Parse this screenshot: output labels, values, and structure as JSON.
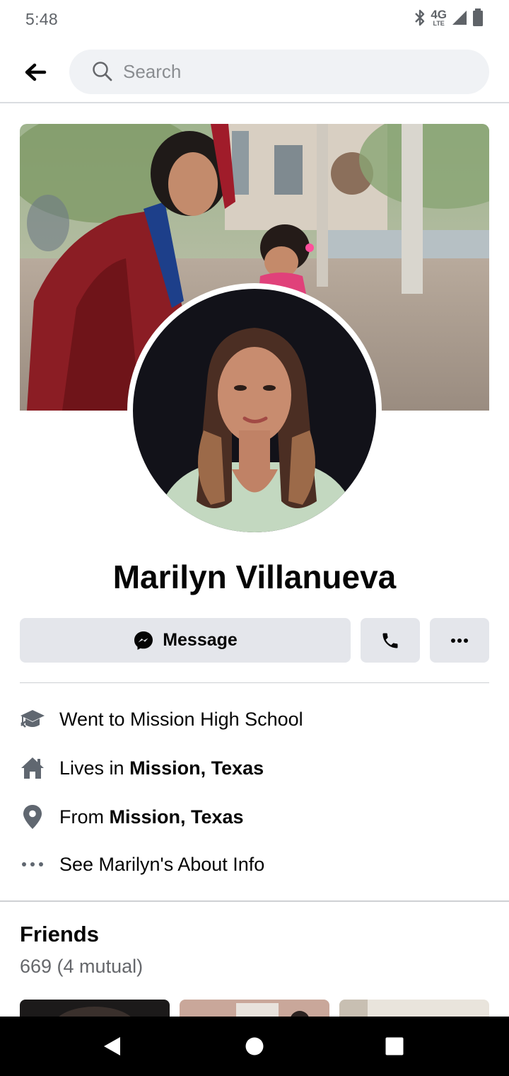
{
  "status_bar": {
    "time": "5:48",
    "network": "4G",
    "network_sub": "LTE"
  },
  "search": {
    "placeholder": "Search"
  },
  "profile": {
    "name": "Marilyn Villanueva"
  },
  "actions": {
    "message_label": "Message"
  },
  "intro": {
    "education": "Went to Mission High School",
    "lives_prefix": "Lives in ",
    "lives_place": "Mission, Texas",
    "from_prefix": "From ",
    "from_place": "Mission, Texas",
    "about_link": "See Marilyn's About Info"
  },
  "friends": {
    "title": "Friends",
    "count": "669 (4 mutual)"
  },
  "colors": {
    "button_bg": "#e4e6eb",
    "search_bg": "#f0f2f5",
    "secondary_text": "#65676b",
    "icon_gray": "#606770"
  }
}
